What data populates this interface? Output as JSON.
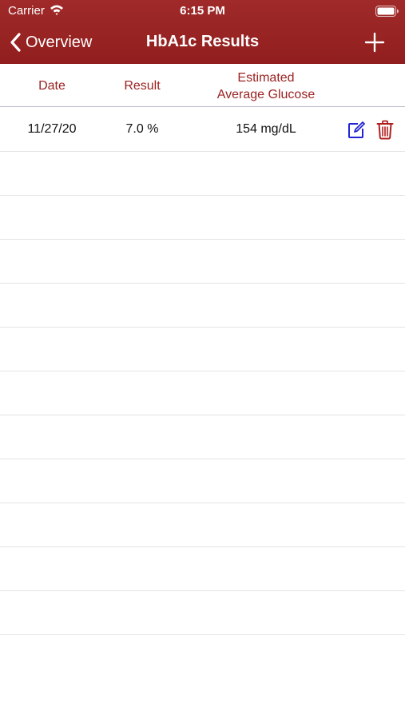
{
  "status_bar": {
    "carrier": "Carrier",
    "time": "6:15 PM"
  },
  "nav": {
    "back_label": "Overview",
    "title": "HbA1c Results",
    "add_icon": "plus-icon"
  },
  "table": {
    "headers": {
      "date": "Date",
      "result": "Result",
      "glucose_line1": "Estimated",
      "glucose_line2": "Average Glucose"
    },
    "rows": [
      {
        "date": "11/27/20",
        "result": "7.0 %",
        "glucose": "154 mg/dL",
        "edit_icon": "edit-icon",
        "delete_icon": "trash-icon"
      },
      {
        "date": "",
        "result": "",
        "glucose": ""
      },
      {
        "date": "",
        "result": "",
        "glucose": ""
      },
      {
        "date": "",
        "result": "",
        "glucose": ""
      },
      {
        "date": "",
        "result": "",
        "glucose": ""
      },
      {
        "date": "",
        "result": "",
        "glucose": ""
      },
      {
        "date": "",
        "result": "",
        "glucose": ""
      },
      {
        "date": "",
        "result": "",
        "glucose": ""
      },
      {
        "date": "",
        "result": "",
        "glucose": ""
      },
      {
        "date": "",
        "result": "",
        "glucose": ""
      },
      {
        "date": "",
        "result": "",
        "glucose": ""
      },
      {
        "date": "",
        "result": "",
        "glucose": ""
      }
    ]
  },
  "colors": {
    "nav_background": "#9b2222",
    "header_text": "#9b2222",
    "edit_icon": "#2323d6",
    "trash_icon": "#b01f1f"
  }
}
